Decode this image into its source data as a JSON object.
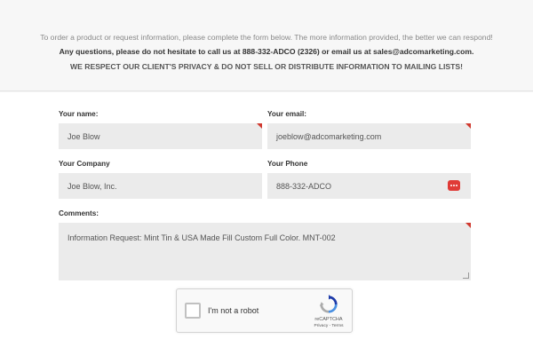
{
  "intro": {
    "line1": "To order a product or request information, please complete the form below. The more information provided, the better we can respond!",
    "line2": "Any questions, please do not hesitate to call us at 888-332-ADCO (2326) or email us at sales@adcomarketing.com.",
    "line3": "WE RESPECT OUR CLIENT'S PRIVACY & DO NOT SELL OR DISTRIBUTE INFORMATION TO MAILING LISTS!"
  },
  "form": {
    "name_label": "Your name:",
    "name_value": "Joe Blow",
    "email_label": "Your email:",
    "email_value": "joeblow@adcomarketing.com",
    "company_label": "Your Company",
    "company_value": "Joe Blow, Inc.",
    "phone_label": "Your Phone",
    "phone_value": "888-332-ADCO",
    "comments_label": "Comments:",
    "comments_value": "Information Request: Mint Tin & USA Made Fill Custom Full Color. MNT-002"
  },
  "captcha": {
    "label": "I'm not a robot",
    "brand": "reCAPTCHA",
    "terms": "Privacy - Terms"
  },
  "colors": {
    "required_marker": "#d0392f",
    "field_bg": "#ebebeb"
  }
}
